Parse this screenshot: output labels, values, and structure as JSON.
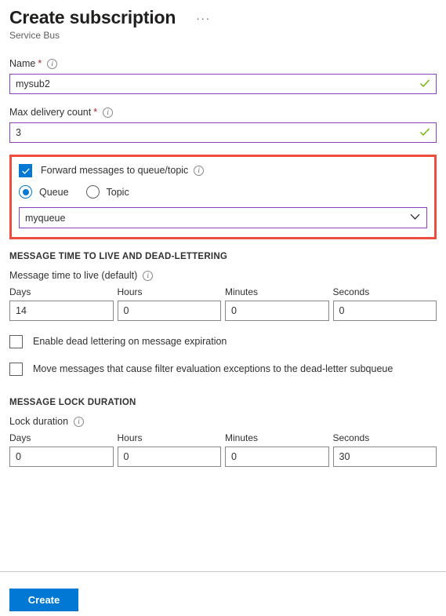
{
  "header": {
    "title": "Create subscription",
    "subtitle": "Service Bus",
    "more_menu": "···"
  },
  "form": {
    "name": {
      "label": "Name",
      "required_marker": "*",
      "info": "i",
      "value": "mysub2",
      "placeholder": ""
    },
    "max_delivery_count": {
      "label": "Max delivery count",
      "required_marker": "*",
      "info": "i",
      "value": "3",
      "placeholder": ""
    }
  },
  "forward_section": {
    "checkbox_label": "Forward messages to queue/topic",
    "checkbox_checked": true,
    "info": "i",
    "radios": [
      {
        "label": "Queue",
        "selected": true
      },
      {
        "label": "Topic",
        "selected": false
      }
    ],
    "dropdown_value": "myqueue",
    "highlight_color": "#ee4c3c"
  },
  "ttl_section": {
    "section_title": "MESSAGE TIME TO LIVE AND DEAD-LETTERING",
    "field_label": "Message time to live (default)",
    "info": "i",
    "units": [
      "Days",
      "Hours",
      "Minutes",
      "Seconds"
    ],
    "values": [
      "14",
      "0",
      "0",
      "0"
    ],
    "checkboxes": [
      {
        "label": "Enable dead lettering on message expiration",
        "checked": false
      },
      {
        "label": "Move messages that cause filter evaluation exceptions to the dead-letter subqueue",
        "checked": false
      }
    ]
  },
  "lock_section": {
    "section_title": "MESSAGE LOCK DURATION",
    "field_label": "Lock duration",
    "info": "i",
    "units": [
      "Days",
      "Hours",
      "Minutes",
      "Seconds"
    ],
    "values": [
      "0",
      "0",
      "0",
      "30"
    ]
  },
  "footer": {
    "create_label": "Create"
  },
  "colors": {
    "accent": "#0078d4",
    "validated_border": "#8a3fbd",
    "valid_check": "#6bb700",
    "required": "#a4262c",
    "highlight": "#ee4c3c"
  }
}
